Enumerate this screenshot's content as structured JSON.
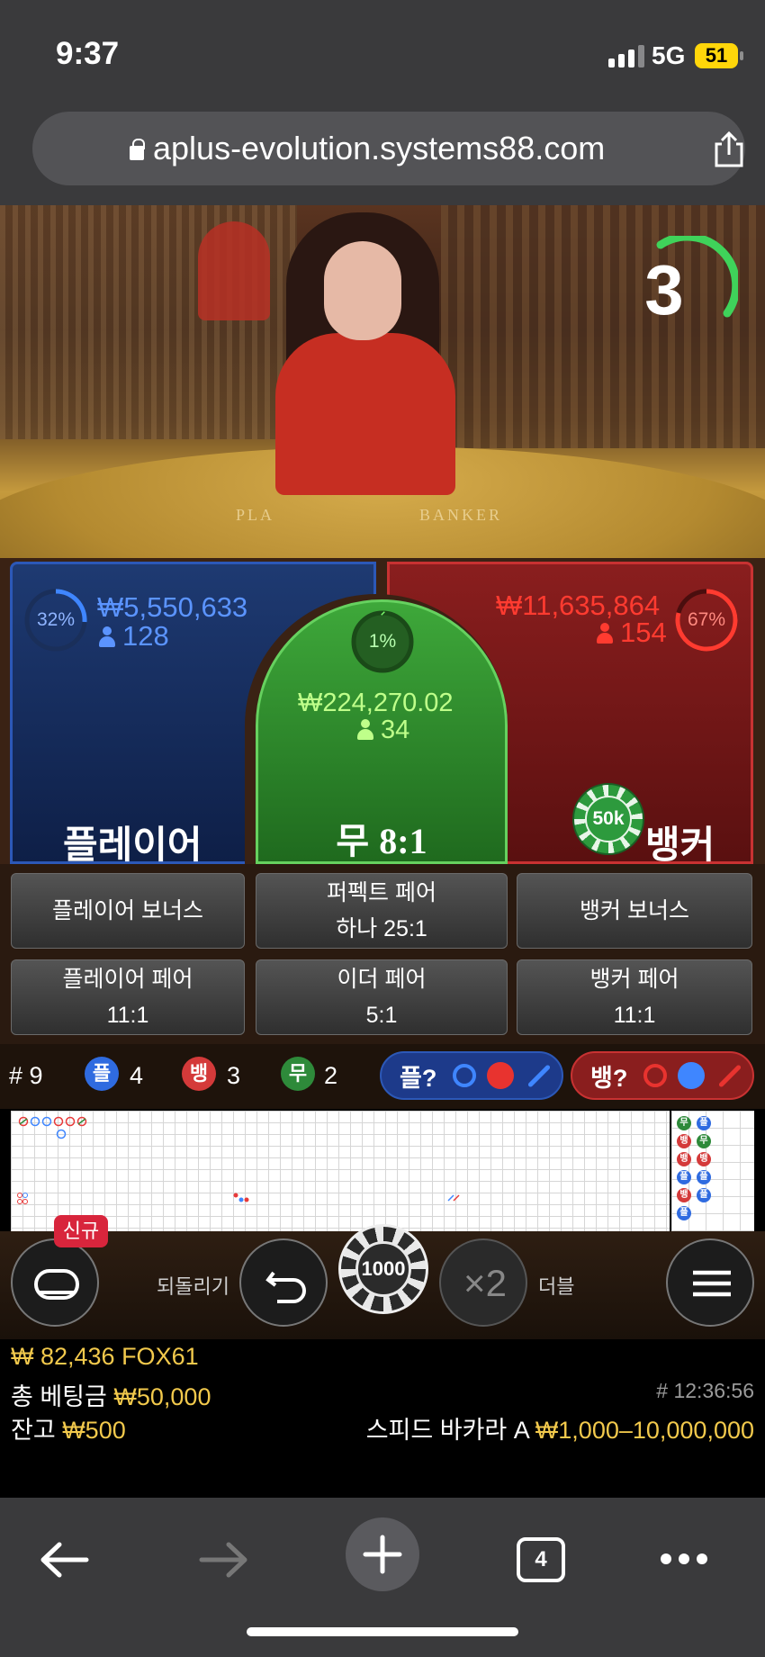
{
  "status": {
    "time": "9:37",
    "network": "5G",
    "battery": "51"
  },
  "browser": {
    "url": "aplus-evolution.systems88.com",
    "tab_count": "4"
  },
  "video": {
    "countdown": "3",
    "table_player": "PLA",
    "table_banker": "BANKER"
  },
  "bets": {
    "player": {
      "percent": "32%",
      "amount": "₩5,550,633",
      "players": "128",
      "label": "플레이어"
    },
    "tie": {
      "percent": "1%",
      "amount": "₩224,270.02",
      "players": "34",
      "label": "무",
      "odds": "8:1"
    },
    "banker": {
      "percent": "67%",
      "amount": "₩11,635,864",
      "players": "154",
      "label": "뱅커"
    },
    "placed_chip": "50k"
  },
  "side_bets": {
    "player_bonus": "플레이어 보너스",
    "perfect_pair_line1": "퍼펙트 페어",
    "perfect_pair_line2": "하나 25:1",
    "banker_bonus": "뱅커 보너스",
    "player_pair_line1": "플레이어 페어",
    "player_pair_line2": "11:1",
    "either_pair_line1": "이더 페어",
    "either_pair_line2": "5:1",
    "banker_pair_line1": "뱅커 페어",
    "banker_pair_line2": "11:1"
  },
  "stats": {
    "round": "# 9",
    "player_badge": "플",
    "player_count": "4",
    "banker_badge": "뱅",
    "banker_count": "3",
    "tie_badge": "무",
    "tie_count": "2",
    "player_predict": "플?",
    "banker_predict": "뱅?"
  },
  "roadmap_side": [
    "무",
    "뱅",
    "뱅",
    "플",
    "뱅",
    "플",
    "플",
    "무",
    "뱅",
    "플",
    "플"
  ],
  "controls": {
    "new_badge": "신규",
    "undo_label": "되돌리기",
    "chip_value": "1000",
    "double_symbol": "×2",
    "double_label": "더블"
  },
  "info": {
    "balance_line": "₩ 82,436 FOX61",
    "total_bet_label": "총 베팅금",
    "total_bet_value": "₩50,000",
    "remain_label": "잔고",
    "remain_value": "₩500",
    "game_id": "# 12:36:56",
    "table_name": "스피드 바카라 A",
    "limits": "₩1,000–10,000,000"
  },
  "colors": {
    "player": "#2c58b7",
    "banker": "#c83232",
    "tie": "#3ea83a",
    "gold": "#f2c94c"
  }
}
